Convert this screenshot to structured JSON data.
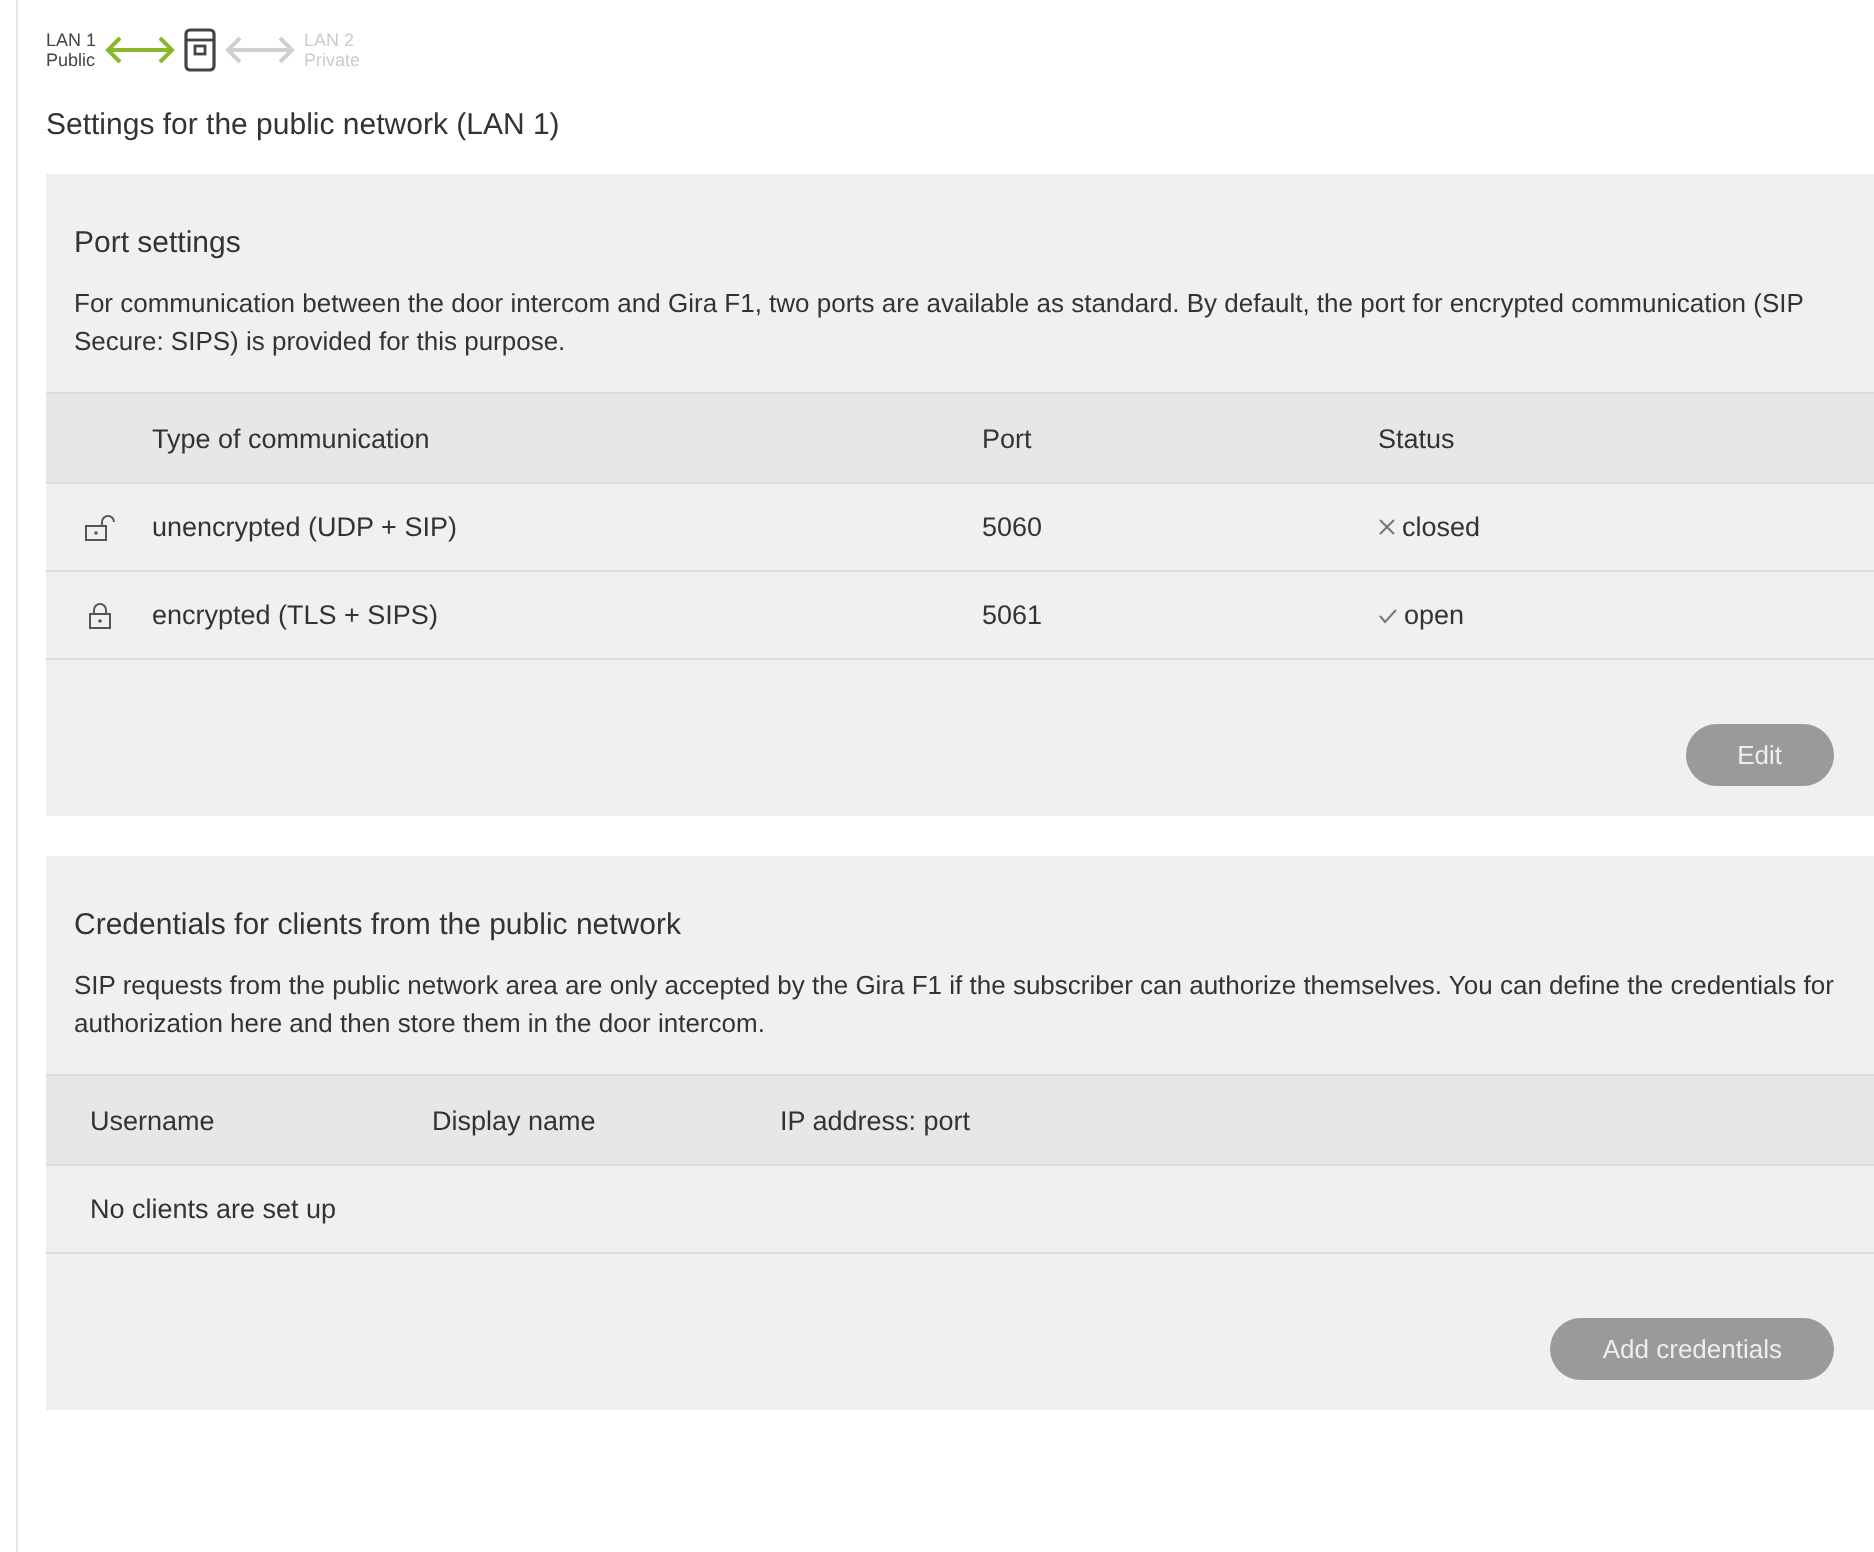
{
  "network_steps": [
    {
      "label": "LAN 1",
      "sublabel": "Public",
      "active": true
    },
    {
      "label": "LAN 2",
      "sublabel": "Private",
      "active": false
    }
  ],
  "page_title": "Settings for the public network (LAN 1)",
  "port_settings": {
    "title": "Port settings",
    "description": "For communication between the door intercom and Gira F1, two ports are available as standard. By default, the port for encrypted communication (SIP Secure: SIPS) is provided for this purpose.",
    "columns": [
      "Type of communication",
      "Port",
      "Status"
    ],
    "rows": [
      {
        "lock": {
          "kind": "unlocked"
        },
        "type": "unencrypted (UDP + SIP)",
        "port": "5060",
        "status": {
          "kind": "closed",
          "text": "closed"
        }
      },
      {
        "lock": {
          "kind": "locked"
        },
        "type": "encrypted (TLS + SIPS)",
        "port": "5061",
        "status": {
          "kind": "open",
          "text": "open"
        }
      }
    ],
    "button": "Edit"
  },
  "credentials": {
    "title": "Credentials for clients from the public network",
    "description": "SIP requests from the public network area are only accepted by the Gira F1 if the subscriber can authorize themselves. You can define the credentials for authorization here and then store them in the door intercom.",
    "columns": [
      "Username",
      "Display name",
      "IP address: port"
    ],
    "empty_text": "No clients are set up",
    "button": "Add credentials"
  }
}
